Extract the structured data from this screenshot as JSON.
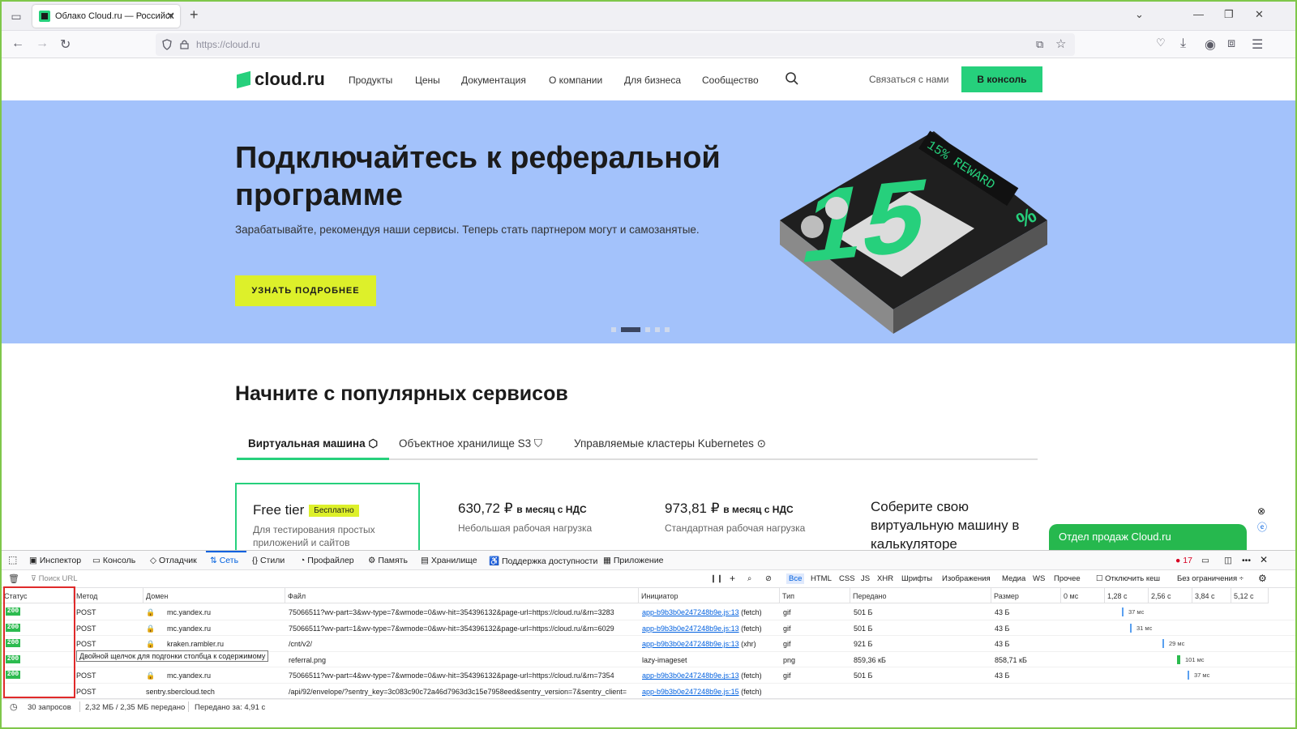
{
  "browser": {
    "tab_title": "Облако Cloud.ru — Российск",
    "url": "https://cloud.ru"
  },
  "site": {
    "logo": "cloud.ru",
    "menu": [
      "Продукты",
      "Цены",
      "Документация",
      "О компании",
      "Для бизнеса",
      "Сообщество"
    ],
    "contact": "Связаться с нами",
    "console_button": "В консоль",
    "accent_color": "#26d07c"
  },
  "hero": {
    "title": "Подключайтесь к реферальной программе",
    "subtitle": "Зарабатывайте, рекомендуя наши сервисы. Теперь стать партнером могут и самозанятые.",
    "button": "УЗНАТЬ ПОДРОБНЕЕ",
    "art_text": "15% REWARD",
    "art_number": "15",
    "art_percent": "%"
  },
  "services": {
    "title": "Начните с популярных сервисов",
    "tabs": [
      "Виртуальная машина",
      "Объектное хранилище S3",
      "Управляемые кластеры Kubernetes"
    ],
    "cards": [
      {
        "title": "Free tier",
        "badge": "Бесплатно",
        "subtitle": "Для тестирования простых приложений и сайтов"
      },
      {
        "price": "630,72 ₽",
        "price_suffix": "в месяц с НДС",
        "subtitle": "Небольшая рабочая нагрузка"
      },
      {
        "price": "973,81 ₽",
        "price_suffix": "в месяц с НДС",
        "subtitle": "Стандартная рабочая нагрузка"
      },
      {
        "title": "Соберите свою виртуальную машину в калькуляторе"
      }
    ],
    "sales_widget": "Отдел продаж Cloud.ru"
  },
  "devtools": {
    "tabs": [
      "Инспектор",
      "Консоль",
      "Отладчик",
      "Сеть",
      "Стили",
      "Профайлер",
      "Память",
      "Хранилище",
      "Поддержка доступности",
      "Приложение"
    ],
    "active_tab": "Сеть",
    "error_count": "17",
    "filter_placeholder": "Поиск URL",
    "type_filters": [
      "Все",
      "HTML",
      "CSS",
      "JS",
      "XHR",
      "Шрифты",
      "Изображения",
      "Медиа",
      "WS",
      "Прочее"
    ],
    "disable_cache": "Отключить кеш",
    "throttle": "Без ограничения ÷",
    "columns": [
      "Статус",
      "Метод",
      "Домен",
      "Файл",
      "Инициатор",
      "Тип",
      "Передано",
      "Размер"
    ],
    "timeline_ticks": [
      "0 мс",
      "1,28 с",
      "2,56 с",
      "3,84 с",
      "5,12 с"
    ],
    "rows": [
      {
        "status": "200",
        "method": "POST",
        "domain": "mc.yandex.ru",
        "file": "75066511?wv-part=3&wv-type=7&wmode=0&wv-hit=354396132&page-url=https://cloud.ru/&rn=3283",
        "initiator": "app-b9b3b0e247248b9e.js:13",
        "init_kind": "(fetch)",
        "type": "gif",
        "transferred": "501 Б",
        "size": "43 Б",
        "timing": "37 мс"
      },
      {
        "status": "200",
        "method": "POST",
        "domain": "mc.yandex.ru",
        "file": "75066511?wv-part=1&wv-type=7&wmode=0&wv-hit=354396132&page-url=https://cloud.ru/&rn=6029",
        "initiator": "app-b9b3b0e247248b9e.js:13",
        "init_kind": "(fetch)",
        "type": "gif",
        "transferred": "501 Б",
        "size": "43 Б",
        "timing": "31 мс"
      },
      {
        "status": "200",
        "method": "POST",
        "domain": "kraken.rambler.ru",
        "file": "/cnt/v2/",
        "initiator": "app-b9b3b0e247248b9e.js:13",
        "init_kind": "(xhr)",
        "type": "gif",
        "transferred": "921 Б",
        "size": "43 Б",
        "timing": "29 мс"
      },
      {
        "status": "200",
        "method": "",
        "domain": "",
        "file": "referral.png",
        "initiator": "lazy-imageset",
        "init_kind": "",
        "type": "png",
        "transferred": "859,36 кБ",
        "size": "858,71 кБ",
        "timing": "101 мс"
      },
      {
        "status": "200",
        "method": "POST",
        "domain": "mc.yandex.ru",
        "file": "75066511?wv-part=4&wv-type=7&wmode=0&wv-hit=354396132&page-url=https://cloud.ru/&rn=7354",
        "initiator": "app-b9b3b0e247248b9e.js:13",
        "init_kind": "(fetch)",
        "type": "gif",
        "transferred": "501 Б",
        "size": "43 Б",
        "timing": "37 мс"
      },
      {
        "status": "",
        "method": "POST",
        "domain": "sentry.sbercloud.tech",
        "file": "/api/92/envelope/?sentry_key=3c083c90c72a46d7963d3c15e7958eed&sentry_version=7&sentry_client=",
        "initiator": "app-b9b3b0e247248b9e.js:15",
        "init_kind": "(fetch)",
        "type": "",
        "transferred": "",
        "size": "",
        "timing": ""
      }
    ],
    "tooltip": "Двойной щелчок для подгонки столбца к содержимому",
    "status_bar": {
      "requests": "30 запросов",
      "transferred": "2,32 МБ / 2,35 МБ передано",
      "finished": "Передано за: 4,91 с"
    }
  }
}
